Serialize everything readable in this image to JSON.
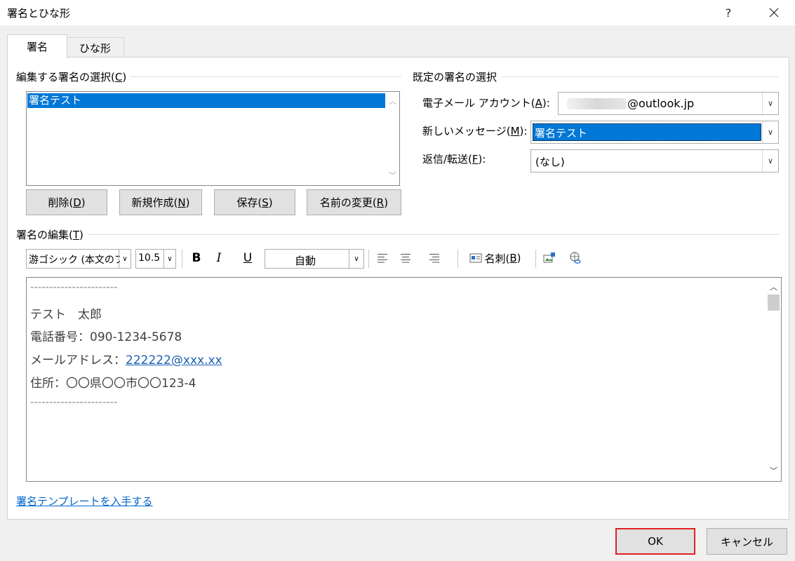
{
  "window": {
    "title": "署名とひな形",
    "help": "?",
    "close": "✕"
  },
  "tabs": [
    {
      "label": "署名",
      "active": true
    },
    {
      "label": "ひな形",
      "active": false
    }
  ],
  "edit_section": {
    "title_main": "編集する署名の選択(",
    "title_key": "C",
    "title_end": ")",
    "list_items": [
      "署名テスト"
    ],
    "selected_index": 0,
    "buttons": {
      "delete": {
        "main": "削除(",
        "key": "D",
        "end": ")"
      },
      "new": {
        "main": "新規作成(",
        "key": "N",
        "end": ")"
      },
      "save": {
        "main": "保存(",
        "key": "S",
        "end": ")"
      },
      "rename": {
        "main": "名前の変更(",
        "key": "R",
        "end": ")"
      }
    }
  },
  "default_section": {
    "title": "既定の署名の選択",
    "account_label": {
      "main": "電子メール アカウント(",
      "key": "A",
      "end": "):"
    },
    "account_value": "@outlook.jp",
    "new_msg_label": {
      "main": "新しいメッセージ(",
      "key": "M",
      "end": "):"
    },
    "new_msg_value": "署名テスト",
    "reply_label": {
      "main": "返信/転送(",
      "key": "F",
      "end": "):"
    },
    "reply_value": "(なし)"
  },
  "editor_section": {
    "title_main": "署名の編集(",
    "title_key": "T",
    "title_end": ")",
    "toolbar": {
      "font": "游ゴシック (本文のフォント)",
      "size": "10.5",
      "bold": "B",
      "italic": "I",
      "underline": "U",
      "color": "自動",
      "business_card": {
        "main": "名刺(",
        "key": "B",
        "end": ")"
      }
    },
    "lines": {
      "dash_top": "-----------------------",
      "name": "テスト　太郎",
      "phone": "電話番号：090-1234-5678",
      "email_prefix": "メールアドレス：",
      "email_link": "222222@xxx.xx",
      "address": "住所：〇〇県〇〇市〇〇123-4",
      "dash_bottom": "-----------------------"
    }
  },
  "template_link": "署名テンプレートを入手する",
  "footer": {
    "ok": "OK",
    "cancel": "キャンセル"
  },
  "colors": {
    "selection": "#0078d7",
    "ok_border": "#e02020",
    "link": "#0066cc"
  }
}
